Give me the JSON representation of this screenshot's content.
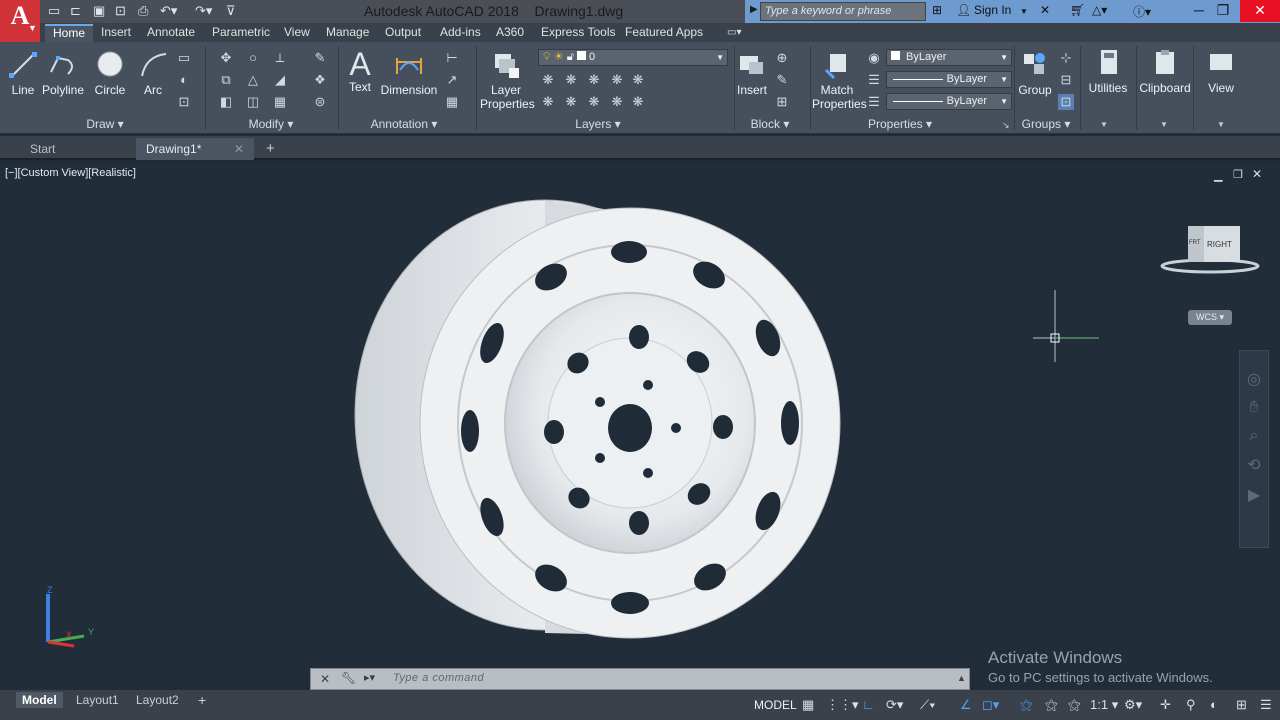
{
  "app": {
    "logo_letter": "A",
    "title": "Autodesk AutoCAD 2018",
    "document": "Drawing1.dwg",
    "search_placeholder": "Type a keyword or phrase",
    "sign_in": "Sign In"
  },
  "ribbon_tabs": [
    "Home",
    "Insert",
    "Annotate",
    "Parametric",
    "View",
    "Manage",
    "Output",
    "Add-ins",
    "A360",
    "Express Tools",
    "Featured Apps"
  ],
  "draw_panel": {
    "title": "Draw",
    "line": "Line",
    "polyline": "Polyline",
    "circle": "Circle",
    "arc": "Arc"
  },
  "modify_panel": {
    "title": "Modify"
  },
  "annotation_panel": {
    "title": "Annotation",
    "text": "Text",
    "dimension": "Dimension"
  },
  "layers_panel": {
    "title": "Layers",
    "layer_properties_1": "Layer",
    "layer_properties_2": "Properties",
    "current_layer": "0"
  },
  "block_panel": {
    "title": "Block",
    "insert": "Insert"
  },
  "properties_panel": {
    "title": "Properties",
    "match_1": "Match",
    "match_2": "Properties",
    "color": "ByLayer",
    "linetype": "ByLayer",
    "lineweight": "ByLayer"
  },
  "groups_panel": {
    "title": "Groups",
    "group": "Group"
  },
  "utilities": "Utilities",
  "clipboard": "Clipboard",
  "view_btn": "View",
  "file_tabs": {
    "start": "Start",
    "drawing": "Drawing1*"
  },
  "viewport": {
    "label": "[−][Custom View][Realistic]",
    "viewcube_face_right": "RIGHT",
    "viewcube_face_front": "FRT",
    "wcs": "WCS",
    "ucs_z": "Z",
    "ucs_y": "Y",
    "ucs_x": "X"
  },
  "command_line": {
    "placeholder": "Type  a  command"
  },
  "layout_tabs": [
    "Model",
    "Layout1",
    "Layout2"
  ],
  "status": {
    "model": "MODEL",
    "scale": "1:1"
  },
  "watermark": {
    "line1": "Activate Windows",
    "line2": "Go to PC settings to activate Windows."
  },
  "colors": {
    "accent": "#6e9bcf",
    "viewport_bg": "#212d38",
    "ribbon_bg": "#46505c",
    "logo_red": "#d13438"
  }
}
